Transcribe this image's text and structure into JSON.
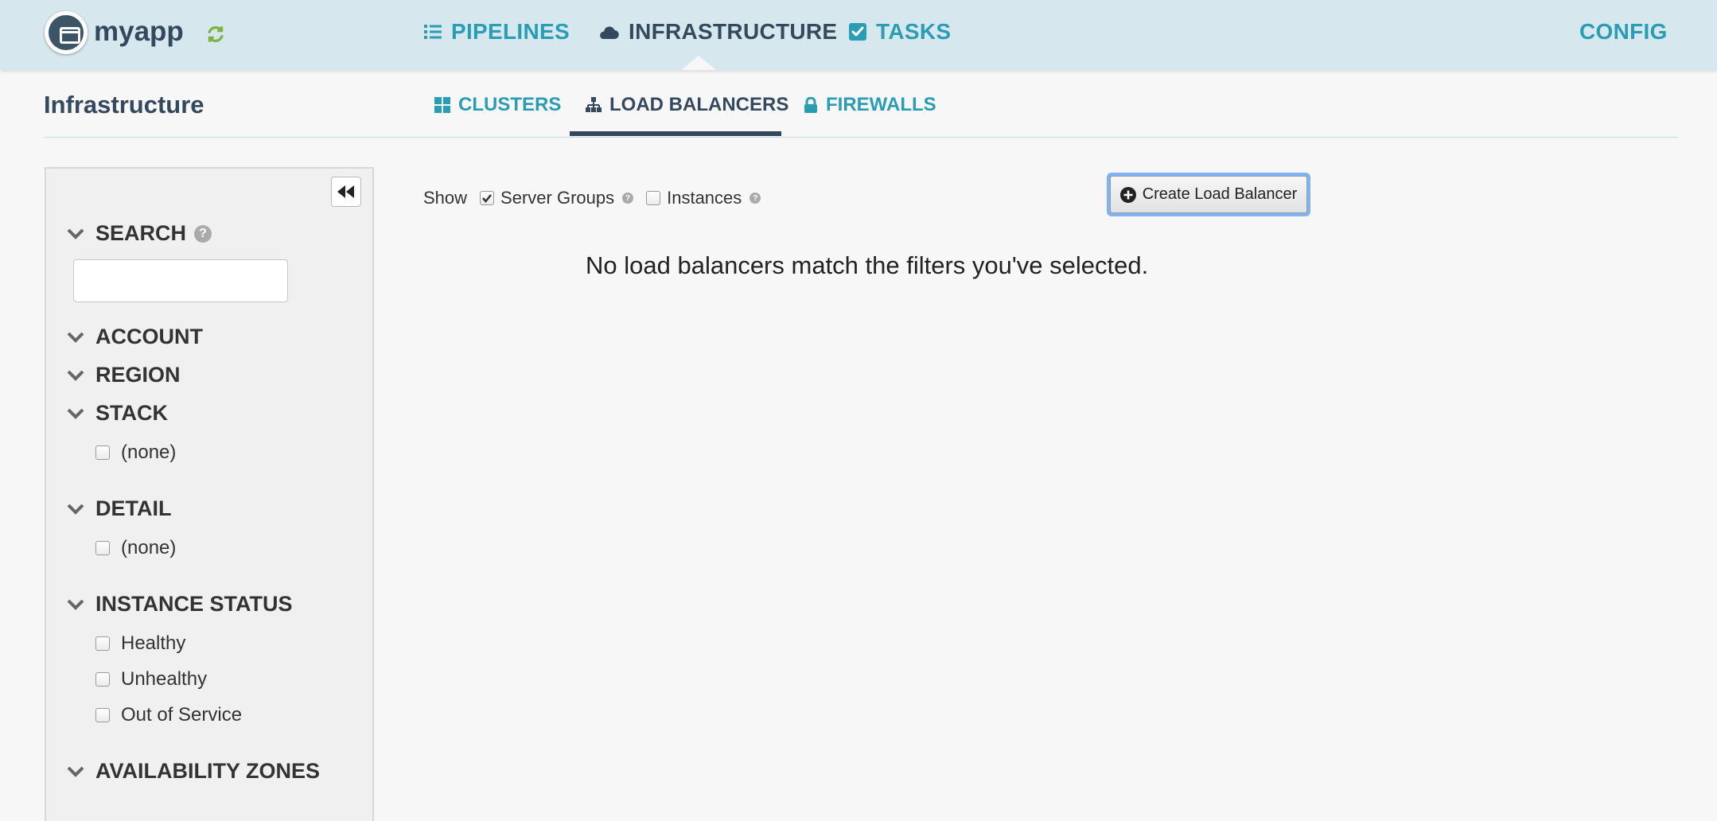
{
  "app": {
    "name": "myapp"
  },
  "nav": {
    "items": [
      {
        "label": "PIPELINES",
        "icon": "list-icon"
      },
      {
        "label": "INFRASTRUCTURE",
        "icon": "cloud-icon"
      },
      {
        "label": "TASKS",
        "icon": "checkbox-square-icon"
      }
    ],
    "config_label": "CONFIG",
    "active": "INFRASTRUCTURE"
  },
  "page": {
    "title": "Infrastructure",
    "tabs": [
      {
        "label": "CLUSTERS",
        "icon": "grid-icon"
      },
      {
        "label": "LOAD BALANCERS",
        "icon": "sitemap-icon"
      },
      {
        "label": "FIREWALLS",
        "icon": "lock-icon"
      }
    ],
    "active_tab": "LOAD BALANCERS"
  },
  "sidebar": {
    "search": {
      "heading": "SEARCH",
      "value": "",
      "placeholder": ""
    },
    "filters": {
      "account": "ACCOUNT",
      "region": "REGION",
      "stack": {
        "heading": "STACK",
        "options": [
          "(none)"
        ]
      },
      "detail": {
        "heading": "DETAIL",
        "options": [
          "(none)"
        ]
      },
      "instance_status": {
        "heading": "INSTANCE STATUS",
        "options": [
          "Healthy",
          "Unhealthy",
          "Out of Service"
        ]
      },
      "availability_zones": "AVAILABILITY ZONES"
    }
  },
  "main": {
    "show_label": "Show",
    "show_options": [
      {
        "label": "Server Groups",
        "checked": true
      },
      {
        "label": "Instances",
        "checked": false
      }
    ],
    "create_button": "Create Load Balancer",
    "empty_message": "No load balancers match the filters you've selected."
  },
  "colors": {
    "header_bg": "#d6e8ee",
    "accent": "#2a9db4",
    "active_text": "#34495e",
    "refresh_green": "#7cb342"
  }
}
